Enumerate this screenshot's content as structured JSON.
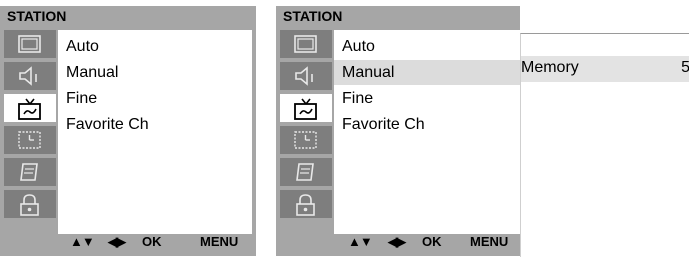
{
  "left_panel": {
    "title": "STATION",
    "icons": [
      "picture-icon",
      "sound-icon",
      "station-tv-icon",
      "time-icon",
      "special-icon",
      "lock-icon"
    ],
    "items": [
      {
        "label": "Auto",
        "selected": false
      },
      {
        "label": "Manual",
        "selected": false
      },
      {
        "label": "Fine",
        "selected": false
      },
      {
        "label": "Favorite Ch",
        "selected": false
      }
    ],
    "footer": {
      "updown": "▲▼",
      "leftright": "◀▶",
      "ok": "OK",
      "menu": "MENU"
    }
  },
  "right_panel": {
    "title": "STATION",
    "icons": [
      "picture-icon",
      "sound-icon",
      "station-tv-icon",
      "time-icon",
      "special-icon",
      "lock-icon"
    ],
    "items": [
      {
        "label": "Auto",
        "selected": false
      },
      {
        "label": "Manual",
        "selected": true
      },
      {
        "label": "Fine",
        "selected": false
      },
      {
        "label": "Favorite Ch",
        "selected": false
      }
    ],
    "footer": {
      "updown": "▲▼",
      "leftright": "◀▶",
      "ok": "OK",
      "menu": "MENU"
    }
  },
  "submenu": {
    "label": "Memory",
    "value": "5"
  },
  "colors": {
    "panel_bg": "#a6a6a6",
    "icon_tile_inactive": "#7e7e7e",
    "icon_tile_active": "#ffffff",
    "list_bg": "#ffffff",
    "selected_row": "#dcdcdc"
  }
}
